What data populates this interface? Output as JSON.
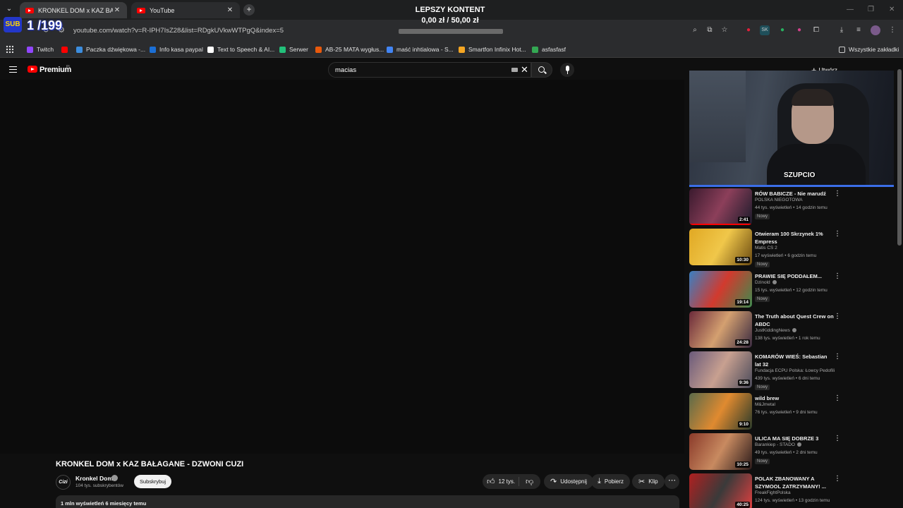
{
  "browser": {
    "tabs": [
      {
        "title": "KRONKEL DOM x KAZ BAŁAGANE",
        "active": true
      },
      {
        "title": "YouTube",
        "active": false
      }
    ],
    "url": "youtube.com/watch?v=R-IPH7IsZ28&list=RDgkUVkwWTPgQ&index=5",
    "bookmarks": [
      {
        "label": "Twitch",
        "color": "#9146ff"
      },
      {
        "label": "",
        "color": "#ff0000"
      },
      {
        "label": "Paczka dźwiękowa -...",
        "color": "#3c8dde"
      },
      {
        "label": "Info kasa paypal",
        "color": "#1b6fd6"
      },
      {
        "label": "Text to Speech & AI...",
        "color": "#ffffff"
      },
      {
        "label": "Serwer",
        "color": "#22c07a"
      },
      {
        "label": "AB-25 MATA wygłus...",
        "color": "#e8590c"
      },
      {
        "label": "maść inhtialowa - S...",
        "color": "#4285f4"
      },
      {
        "label": "Smartfon Infinix Hot...",
        "color": "#f5a623"
      },
      {
        "label": "asfasfasf",
        "color": "#34a853"
      }
    ],
    "all_bookmarks": "Wszystkie zakładki"
  },
  "overlay": {
    "sub_badge": "SUB",
    "sub_count": "1 /199",
    "goal_title": "LEPSZY KONTENT",
    "goal_amount": "0,00 zł / 50,00 zł",
    "goal_progress": 0.0,
    "webcam_label": "SZUPCIO"
  },
  "youtube": {
    "logo": "Premium",
    "logo_region": "PL",
    "search_value": "macias",
    "create_label": "Utwórz"
  },
  "video": {
    "title": "KRONKEL DOM x KAZ BAŁAGANE - DZWONI CUZI",
    "channel": "Kronkel Dom",
    "channel_avatar": "Cizi",
    "subscribers": "104 tys. subskrybentów",
    "subscribe_label": "Subskrybuj",
    "likes": "12 tys.",
    "share_label": "Udostępnij",
    "download_label": "Pobierz",
    "clip_label": "Klip",
    "views_date": "1 mln wyświetleń  6 miesięcy temu"
  },
  "recommendations": [
    {
      "title": "RÓW BABICZE - Nie marudź",
      "channel": "POLSKA NIEGOTOWA",
      "verified": false,
      "meta": "44 tys. wyświetleń • 14 godzin temu",
      "badge": "Nowy",
      "duration": "2:41",
      "watched": true,
      "colors": [
        "#3a1a2e",
        "#8c3f5a",
        "#1b1b2b"
      ]
    },
    {
      "title": "Otwieram 100 Skrzynek 1% Empress",
      "channel": "Matis CS 2",
      "verified": false,
      "meta": "17 wyświetleń • 6 godzin temu",
      "badge": "Nowy",
      "duration": "10:30",
      "watched": false,
      "colors": [
        "#e0a823",
        "#f0c74a",
        "#6b4a10"
      ]
    },
    {
      "title": "PRAWIE SIĘ PODDAŁEM...",
      "channel": "Dzinold",
      "verified": true,
      "meta": "15 tys. wyświetleń • 12 godzin temu",
      "badge": "Nowy",
      "duration": "19:14",
      "watched": false,
      "colors": [
        "#3a7fc2",
        "#d23a2e",
        "#3f8a4e"
      ]
    },
    {
      "title": "The Truth about Quest Crew on ABDC",
      "channel": "JustKiddingNews",
      "verified": true,
      "meta": "138 tys. wyświetleń • 1 rok temu",
      "badge": "",
      "duration": "24:28",
      "watched": false,
      "colors": [
        "#6b2a3a",
        "#d4a070",
        "#3a2a40"
      ]
    },
    {
      "title": "KOMARÓW WIEŚ: Sebastian lat 32",
      "channel": "Fundacja ECPU Polska: Łowcy Pedofili",
      "verified": false,
      "meta": "439 tys. wyświetleń • 6 dni temu",
      "badge": "Nowy",
      "duration": "9:36",
      "watched": false,
      "colors": [
        "#6a5a7a",
        "#c8a090",
        "#4a4a5a"
      ]
    },
    {
      "title": "wild brew",
      "channel": "M&Jmetal",
      "verified": false,
      "meta": "76 tys. wyświetleń • 9 dni temu",
      "badge": "",
      "duration": "9:10",
      "watched": false,
      "colors": [
        "#5a6a4a",
        "#e08a30",
        "#2a3a2a"
      ]
    },
    {
      "title": "ULICA MA SIĘ DOBRZE 3",
      "channel": "Barankiep - STADO",
      "verified": true,
      "meta": "49 tys. wyświetleń • 2 dni temu",
      "badge": "Nowy",
      "duration": "10:25",
      "watched": false,
      "colors": [
        "#8a3a2a",
        "#c88a60",
        "#2a1a1a"
      ]
    },
    {
      "title": "POLAK ZBANOWANY A SZYMOOL ZATRZYMANY! ...",
      "channel": "FreakFightPolska",
      "verified": false,
      "meta": "124 tys. wyświetleń • 13 godzin temu",
      "badge": "",
      "duration": "40:25",
      "watched": false,
      "colors": [
        "#b02020",
        "#3a3a3a",
        "#e04040"
      ]
    }
  ]
}
